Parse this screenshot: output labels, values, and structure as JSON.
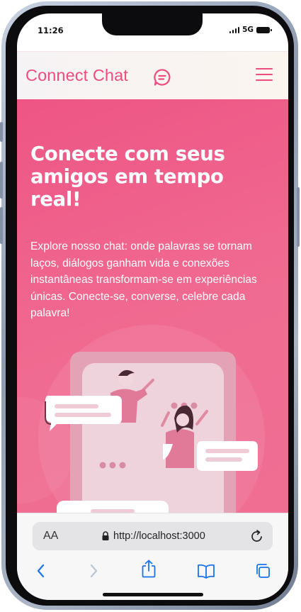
{
  "status": {
    "time": "11:26",
    "network": "5G"
  },
  "header": {
    "brand": "Connect Chat"
  },
  "hero": {
    "title": "Conecte com seus amigos em tempo real!",
    "description": "Explore nosso chat: onde palavras se tornam laços, diálogos ganham vida e conexões instantâneas transformam-se em experiências únicas. Conecte-se, converse, celebre cada palavra!"
  },
  "browser": {
    "text_size_label": "AA",
    "url": "http://localhost:3000"
  },
  "colors": {
    "brand": "#ec4c80",
    "hero_bg": "#ee5585",
    "illustration": "#e8bcc9"
  },
  "icons": [
    "chat-bubble-icon",
    "hamburger-menu-icon",
    "lock-icon",
    "reload-icon",
    "back-icon",
    "forward-icon",
    "share-icon",
    "bookmarks-icon",
    "tabs-icon"
  ]
}
